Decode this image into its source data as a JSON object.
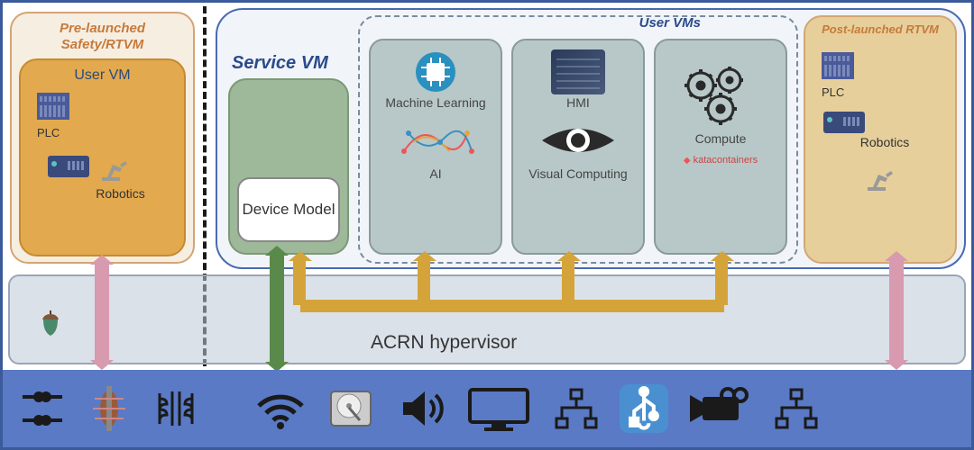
{
  "pre_launched": {
    "title": "Pre-launched Safety/RTVM",
    "user_vm_label": "User VM",
    "plc_label": "PLC",
    "robotics_label": "Robotics"
  },
  "service_vm": {
    "label": "Service VM",
    "device_model": "Device Model"
  },
  "user_vms": {
    "group_title": "User VMs",
    "vm1": {
      "top": "Machine Learning",
      "bottom": "AI"
    },
    "vm2": {
      "top": "HMI",
      "bottom": "Visual Computing"
    },
    "vm3": {
      "top": "Compute",
      "bottom": "katacontainers"
    }
  },
  "post_launched": {
    "title": "Post-launched RTVM",
    "plc_label": "PLC",
    "robotics_label": "Robotics"
  },
  "hypervisor": {
    "label": "ACRN hypervisor"
  }
}
